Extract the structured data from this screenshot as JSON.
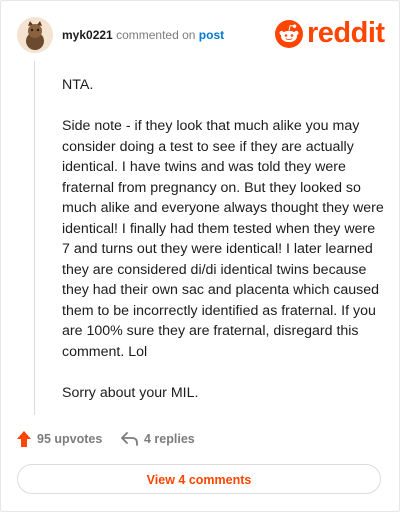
{
  "comment": {
    "username": "myk0221",
    "commented_on": "commented on",
    "post_link": "post",
    "paragraphs": [
      "NTA.",
      "Side note - if they look that much alike you may consider doing a test to see if they are actually identical. I have twins and was told they were fraternal from pregnancy on. But they looked so much alike and everyone always thought they were identical! I finally had them tested when they were 7 and turns out they were identical! I later learned they are considered di/di identical twins because they had their own sac and placenta which caused them to be incorrectly identified as fraternal. If you are 100% sure they are fraternal, disregard this comment. Lol",
      "Sorry about your MIL."
    ]
  },
  "brand": {
    "logo_text": "reddit",
    "accent": "#ff4500"
  },
  "actions": {
    "upvotes": "95 upvotes",
    "replies": "4 replies",
    "upvote_icon": "upvote-arrow-icon",
    "reply_icon": "reply-icon"
  },
  "footer": {
    "view_button": "View 4 comments"
  },
  "colors": {
    "link": "#0079d3",
    "muted": "#7c7c7c",
    "text": "#1c1c1c"
  }
}
